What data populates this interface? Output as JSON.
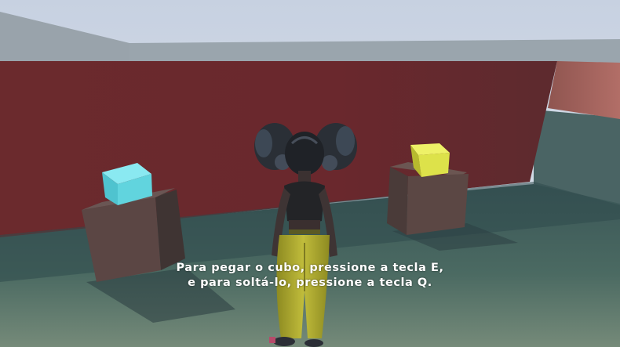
{
  "hud": {
    "instruction_line_1": "Para pegar o cubo, pressione a tecla E,",
    "instruction_line_2": "e para soltá-lo, pressione a tecla Q."
  },
  "scene": {
    "pickups": [
      {
        "name": "cyan-cube",
        "color": "#5fd8e3"
      },
      {
        "name": "yellow-cube",
        "color": "#e0e34a"
      }
    ],
    "colors": {
      "sky": "#c9d4e0",
      "wall_red": "#6b2a2e",
      "floor": "#3f5b5d"
    }
  }
}
